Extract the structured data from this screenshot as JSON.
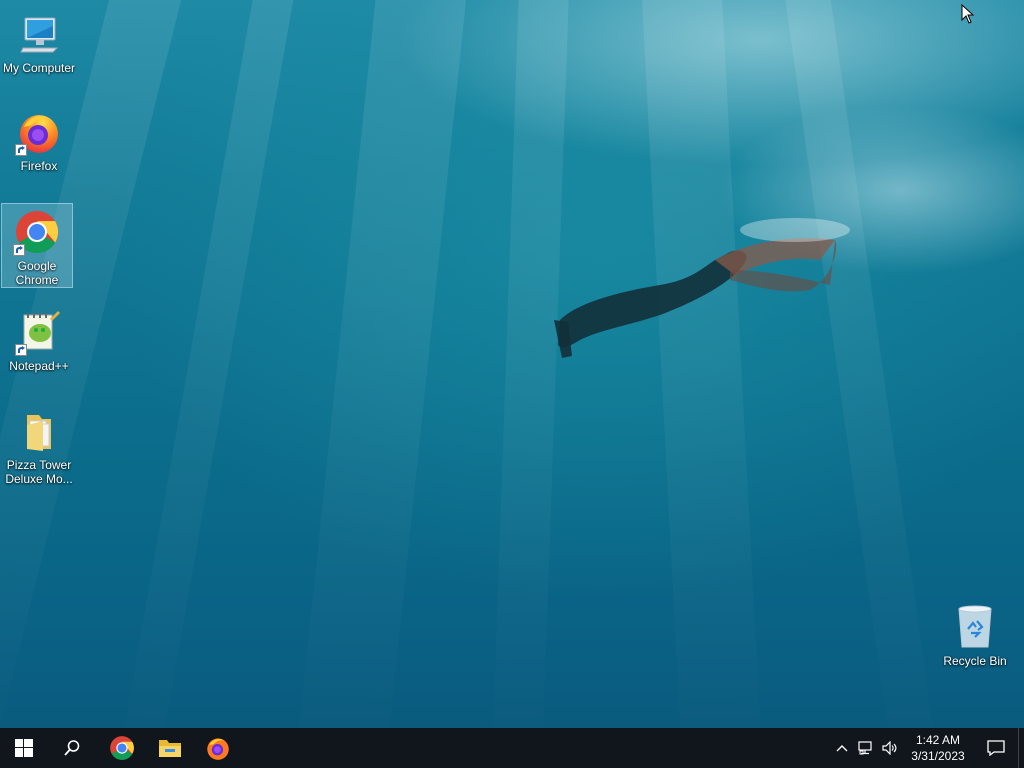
{
  "desktop": {
    "icons": [
      {
        "label": "My Computer",
        "icon": "computer-icon"
      },
      {
        "label": "Firefox",
        "icon": "firefox-icon"
      },
      {
        "label": "Google Chrome",
        "icon": "chrome-icon"
      },
      {
        "label": "Notepad++",
        "icon": "notepadpp-icon"
      },
      {
        "label": "Pizza Tower Deluxe Mo...",
        "icon": "folder-icon"
      },
      {
        "label": "Recycle Bin",
        "icon": "recycle-bin-icon"
      }
    ],
    "selected": "Google Chrome"
  },
  "taskbar": {
    "start": "windows-start-icon",
    "search": "search-icon",
    "pinned": [
      "chrome-icon",
      "file-explorer-icon",
      "firefox-icon"
    ],
    "tray": {
      "icons": [
        "chevron-up-icon",
        "network-icon",
        "volume-icon"
      ],
      "time": "1:42 AM",
      "date": "3/31/2023",
      "notification": "action-center-icon"
    }
  },
  "colors": {
    "taskbar_bg": "#10161c",
    "wallpaper_mid": "#0e7391"
  }
}
